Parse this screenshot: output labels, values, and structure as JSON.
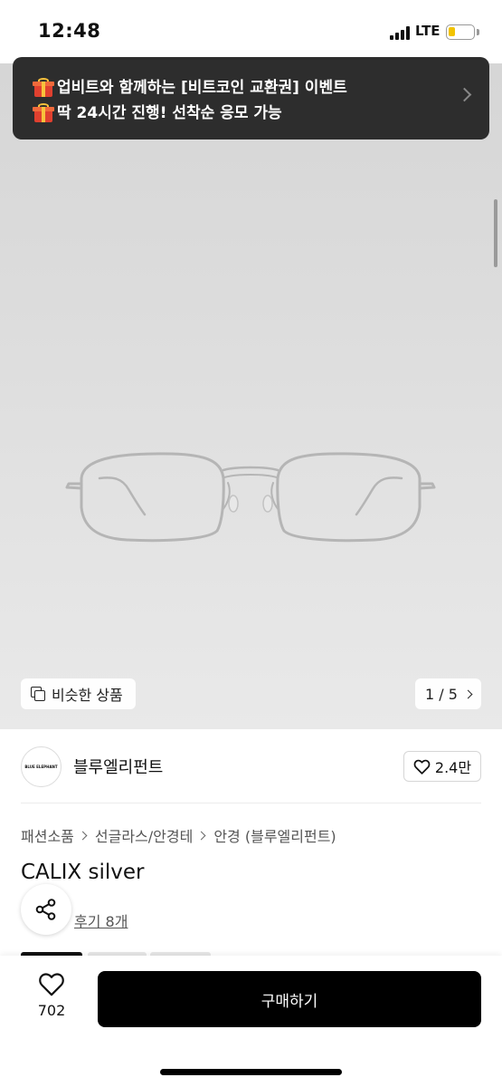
{
  "status_bar": {
    "time": "12:48",
    "network": "LTE",
    "battery_level": 0.25,
    "battery_color": "#f2c300"
  },
  "promo_banner": {
    "line1": "업비트와 함께하는 [비트코인 교환권] 이벤트",
    "line2": "딱 24시간 진행! 선착순 응모 가능",
    "icon": "gift-icon",
    "background": "#2d2d2d"
  },
  "hero": {
    "similar_label": "비슷한 상품",
    "pager": "1 / 5",
    "image": "silver-wire-glasses"
  },
  "store": {
    "name": "블루엘리펀트",
    "logo_text": "BLUE ELEPHANT",
    "like_count": "2.4만"
  },
  "breadcrumb": [
    "패션소품",
    "선글라스/안경테",
    "안경 (블루엘리펀트)"
  ],
  "product": {
    "title": "CALIX silver",
    "review_link": "후기 8개"
  },
  "bottom_bar": {
    "wish_count": "702",
    "buy_label": "구매하기"
  }
}
